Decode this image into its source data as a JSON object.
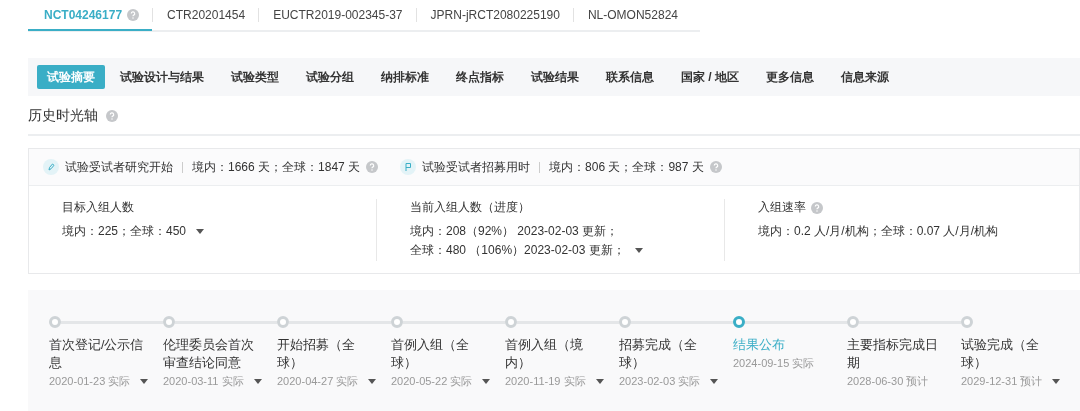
{
  "registry_tabs": [
    {
      "label": "NCT04246177",
      "selected": true,
      "help": true
    },
    {
      "label": "CTR20201454",
      "selected": false,
      "help": false
    },
    {
      "label": "EUCTR2019-002345-37",
      "selected": false,
      "help": false
    },
    {
      "label": "JPRN-jRCT2080225190",
      "selected": false,
      "help": false
    },
    {
      "label": "NL-OMON52824",
      "selected": false,
      "help": false
    }
  ],
  "section_nav": [
    {
      "label": "试验摘要",
      "selected": true
    },
    {
      "label": "试验设计与结果",
      "selected": false
    },
    {
      "label": "试验类型",
      "selected": false
    },
    {
      "label": "试验分组",
      "selected": false
    },
    {
      "label": "纳排标准",
      "selected": false
    },
    {
      "label": "终点指标",
      "selected": false
    },
    {
      "label": "试验结果",
      "selected": false
    },
    {
      "label": "联系信息",
      "selected": false
    },
    {
      "label": "国家 / 地区",
      "selected": false
    },
    {
      "label": "更多信息",
      "selected": false
    },
    {
      "label": "信息来源",
      "selected": false
    }
  ],
  "section_title": "历史时光轴",
  "durations": [
    {
      "kind": "start",
      "label": "试验受试者研究开始",
      "value": "境内：1666 天；全球：1847 天"
    },
    {
      "kind": "recruit",
      "label": "试验受试者招募用时",
      "value": "境内：806 天；全球：987 天"
    }
  ],
  "metrics": [
    {
      "title": "目标入组人数",
      "help": false,
      "lines": [
        "境内：225；全球：450"
      ],
      "expandable": true
    },
    {
      "title": "当前入组人数（进度）",
      "help": false,
      "lines": [
        "境内：208（92%） 2023-02-03 更新；",
        "全球：480 （106%）2023-02-03 更新；"
      ],
      "expandable": true
    },
    {
      "title": "入组速率",
      "help": true,
      "lines": [
        "境内：0.2 人/月/机构；全球：0.07 人/月/机构"
      ],
      "expandable": false
    }
  ],
  "timeline": [
    {
      "title": "首次登记/公示信息",
      "date": "2020-01-23 实际",
      "selected": false,
      "expandable": true
    },
    {
      "title": "伦理委员会首次审查结论同意",
      "date": "2020-03-11 实际",
      "selected": false,
      "expandable": true
    },
    {
      "title": "开始招募（全球）",
      "date": "2020-04-27 实际",
      "selected": false,
      "expandable": true
    },
    {
      "title": "首例入组（全球）",
      "date": "2020-05-22 实际",
      "selected": false,
      "expandable": true
    },
    {
      "title": "首例入组（境内）",
      "date": "2020-11-19 实际",
      "selected": false,
      "expandable": true
    },
    {
      "title": "招募完成（全球）",
      "date": "2023-02-03 实际",
      "selected": false,
      "expandable": true
    },
    {
      "title": "结果公布",
      "date": "2024-09-15 实际",
      "selected": true,
      "expandable": false
    },
    {
      "title": "主要指标完成日期",
      "date": "2028-06-30 预计",
      "selected": false,
      "expandable": false
    },
    {
      "title": "试验完成（全球）",
      "date": "2029-12-31 预计",
      "selected": false,
      "expandable": true
    }
  ]
}
